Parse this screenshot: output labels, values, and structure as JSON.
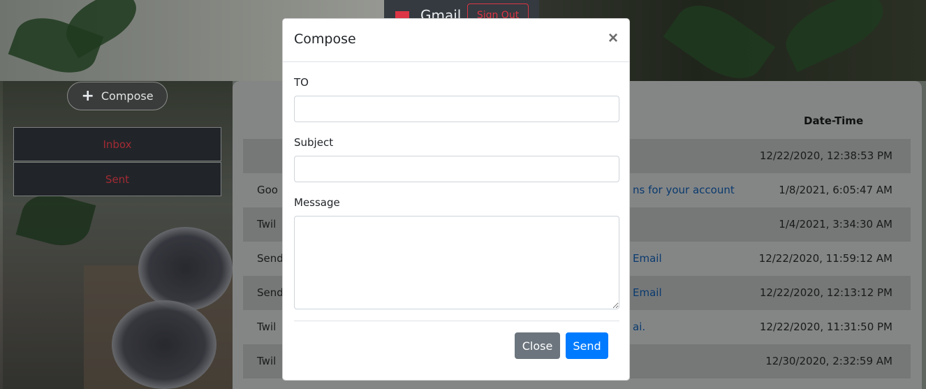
{
  "navbar": {
    "brand": "Gmail",
    "sign_out": "Sign Out",
    "icon": "mail-icon",
    "accent": "#dc3545"
  },
  "sidebar": {
    "compose_label": "Compose",
    "compose_icon": "plus-icon",
    "items": [
      {
        "label": "Inbox"
      },
      {
        "label": "Sent"
      }
    ]
  },
  "mail_list": {
    "header_date": "Date-Time",
    "rows": [
      {
        "sender": "",
        "subject": "",
        "date": "12/22/2020, 12:38:53 PM"
      },
      {
        "sender": "Goo",
        "subject": "ns for your account",
        "date": "1/8/2021, 6:05:47 AM"
      },
      {
        "sender": "Twil",
        "subject": "",
        "date": "1/4/2021, 3:34:30 AM"
      },
      {
        "sender": "Send",
        "subject": "Email",
        "date": "12/22/2020, 11:59:12 AM"
      },
      {
        "sender": "Send",
        "subject": "Email",
        "date": "12/22/2020, 12:13:12 PM"
      },
      {
        "sender": "Twil",
        "subject": "ai.",
        "date": "12/22/2020, 11:31:50 PM"
      },
      {
        "sender": "Twil",
        "subject": "",
        "date": "12/30/2020, 2:32:59 AM"
      }
    ]
  },
  "modal": {
    "title": "Compose",
    "close_symbol": "×",
    "to_label": "TO",
    "to_value": "",
    "subject_label": "Subject",
    "subject_value": "",
    "message_label": "Message",
    "message_value": "",
    "close_button": "Close",
    "send_button": "Send",
    "colors": {
      "close": "#6c757d",
      "send": "#007bff"
    }
  }
}
